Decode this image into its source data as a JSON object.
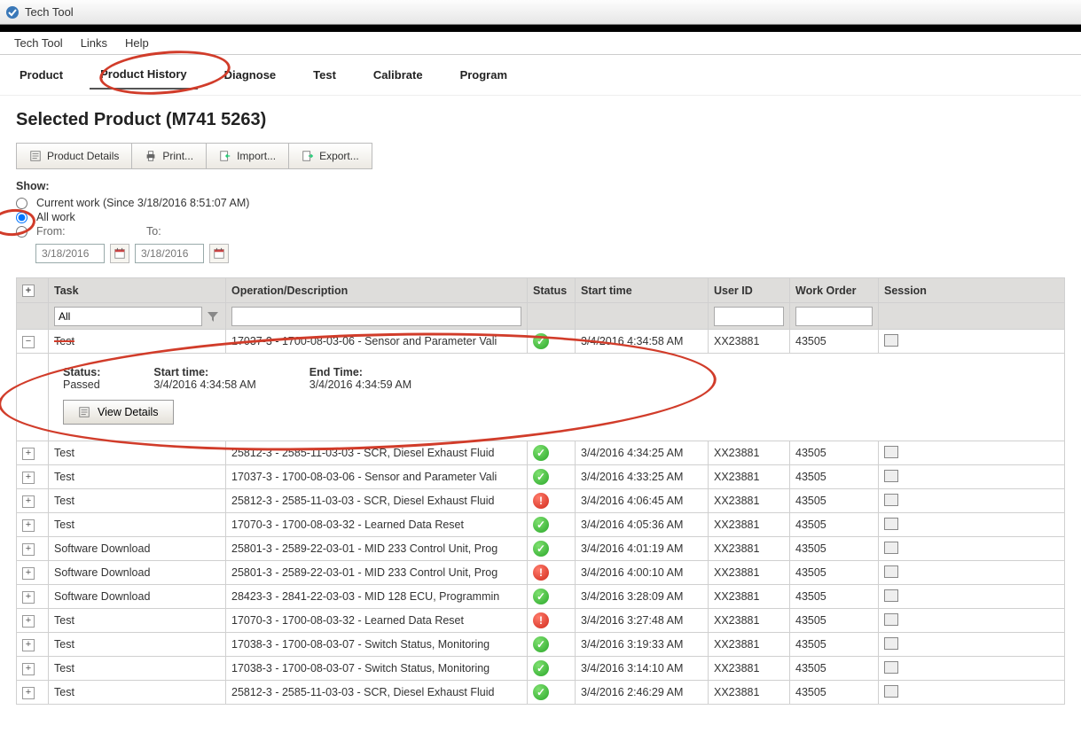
{
  "window": {
    "title": "Tech Tool"
  },
  "menubar": {
    "items": [
      "Tech Tool",
      "Links",
      "Help"
    ]
  },
  "tabs": [
    "Product",
    "Product History",
    "Diagnose",
    "Test",
    "Calibrate",
    "Program"
  ],
  "tabs_active_index": 1,
  "page": {
    "title": "Selected Product (M741 5263)"
  },
  "toolbar": {
    "product_details": "Product Details",
    "print": "Print...",
    "import": "Import...",
    "export": "Export..."
  },
  "filter": {
    "show_label": "Show:",
    "current_label": "Current work (Since 3/18/2016 8:51:07 AM)",
    "all_label": "All work",
    "from_label": "From:",
    "to_label": "To:",
    "from_value": "3/18/2016",
    "to_value": "3/18/2016",
    "selected": "all"
  },
  "columns": {
    "task": "Task",
    "op": "Operation/Description",
    "status": "Status",
    "start": "Start time",
    "user": "User ID",
    "wo": "Work Order",
    "session": "Session"
  },
  "task_filter_value": "All",
  "detail": {
    "status_label": "Status:",
    "status_value": "Passed",
    "start_label": "Start time:",
    "start_value": "3/4/2016 4:34:58 AM",
    "end_label": "End Time:",
    "end_value": "3/4/2016 4:34:59 AM",
    "view_details": "View Details"
  },
  "rows": [
    {
      "expanded": true,
      "task": "Test",
      "op": "17037-3 - 1700-08-03-06 - Sensor and Parameter Vali",
      "status": "ok",
      "start": "3/4/2016 4:34:58 AM",
      "user": "XX23881",
      "wo": "43505"
    },
    {
      "expanded": false,
      "task": "Test",
      "op": "25812-3 - 2585-11-03-03 - SCR, Diesel Exhaust Fluid",
      "status": "ok",
      "start": "3/4/2016 4:34:25 AM",
      "user": "XX23881",
      "wo": "43505"
    },
    {
      "expanded": false,
      "task": "Test",
      "op": "17037-3 - 1700-08-03-06 - Sensor and Parameter Vali",
      "status": "ok",
      "start": "3/4/2016 4:33:25 AM",
      "user": "XX23881",
      "wo": "43505"
    },
    {
      "expanded": false,
      "task": "Test",
      "op": "25812-3 - 2585-11-03-03 - SCR, Diesel Exhaust Fluid",
      "status": "bad",
      "start": "3/4/2016 4:06:45 AM",
      "user": "XX23881",
      "wo": "43505"
    },
    {
      "expanded": false,
      "task": "Test",
      "op": "17070-3 - 1700-08-03-32 - Learned Data Reset",
      "status": "ok",
      "start": "3/4/2016 4:05:36 AM",
      "user": "XX23881",
      "wo": "43505"
    },
    {
      "expanded": false,
      "task": "Software Download",
      "op": "25801-3 - 2589-22-03-01 - MID 233 Control Unit, Prog",
      "status": "ok",
      "start": "3/4/2016 4:01:19 AM",
      "user": "XX23881",
      "wo": "43505"
    },
    {
      "expanded": false,
      "task": "Software Download",
      "op": "25801-3 - 2589-22-03-01 - MID 233 Control Unit, Prog",
      "status": "bad",
      "start": "3/4/2016 4:00:10 AM",
      "user": "XX23881",
      "wo": "43505"
    },
    {
      "expanded": false,
      "task": "Software Download",
      "op": "28423-3 - 2841-22-03-03 - MID 128 ECU, Programmin",
      "status": "ok",
      "start": "3/4/2016 3:28:09 AM",
      "user": "XX23881",
      "wo": "43505"
    },
    {
      "expanded": false,
      "task": "Test",
      "op": "17070-3 - 1700-08-03-32 - Learned Data Reset",
      "status": "bad",
      "start": "3/4/2016 3:27:48 AM",
      "user": "XX23881",
      "wo": "43505"
    },
    {
      "expanded": false,
      "task": "Test",
      "op": "17038-3 - 1700-08-03-07 - Switch Status, Monitoring",
      "status": "ok",
      "start": "3/4/2016 3:19:33 AM",
      "user": "XX23881",
      "wo": "43505"
    },
    {
      "expanded": false,
      "task": "Test",
      "op": "17038-3 - 1700-08-03-07 - Switch Status, Monitoring",
      "status": "ok",
      "start": "3/4/2016 3:14:10 AM",
      "user": "XX23881",
      "wo": "43505"
    },
    {
      "expanded": false,
      "task": "Test",
      "op": "25812-3 - 2585-11-03-03 - SCR, Diesel Exhaust Fluid",
      "status": "ok",
      "start": "3/4/2016 2:46:29 AM",
      "user": "XX23881",
      "wo": "43505"
    }
  ]
}
